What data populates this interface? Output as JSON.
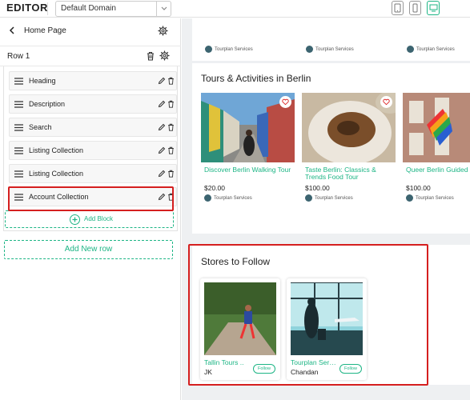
{
  "app": {
    "title": "EDITOR"
  },
  "domain": {
    "selected": "Default Domain"
  },
  "devices": [
    {
      "icon": "tablet-icon",
      "active": false
    },
    {
      "icon": "mobile-icon",
      "active": false
    },
    {
      "icon": "desktop-icon",
      "active": true
    }
  ],
  "colors": {
    "accent": "#1db585",
    "highlight": "#d51f1f"
  },
  "sidebar": {
    "page_label": "Home Page",
    "row_label": "Row 1",
    "blocks": [
      {
        "label": "Heading"
      },
      {
        "label": "Description"
      },
      {
        "label": "Search"
      },
      {
        "label": "Listing Collection"
      },
      {
        "label": "Listing Collection"
      },
      {
        "label": "Account Collection"
      }
    ],
    "add_block_label": "Add Block",
    "add_row_label": "Add New row"
  },
  "preview": {
    "top_row_sellers": [
      "Tourplan Services",
      "Tourplan Services",
      "Tourplan Services"
    ],
    "tours": {
      "title": "Tours & Activities in Berlin",
      "items": [
        {
          "name": "Discover Berlin Walking Tour",
          "price": "$20.00",
          "seller": "Tourplan Services"
        },
        {
          "name": "Taste Berlin: Classics & Trends Food Tour",
          "price": "$100.00",
          "seller": "Tourplan Services"
        },
        {
          "name": "Queer Berlin Guided",
          "price": "$100.00",
          "seller": "Tourplan Services"
        }
      ]
    },
    "stores": {
      "title": "Stores to Follow",
      "items": [
        {
          "name": "Tallin Tours ..",
          "owner": "JK",
          "follow_label": "Follow"
        },
        {
          "name": "Tourplan Serv...",
          "owner": "Chandan",
          "follow_label": "Follow"
        }
      ]
    }
  }
}
